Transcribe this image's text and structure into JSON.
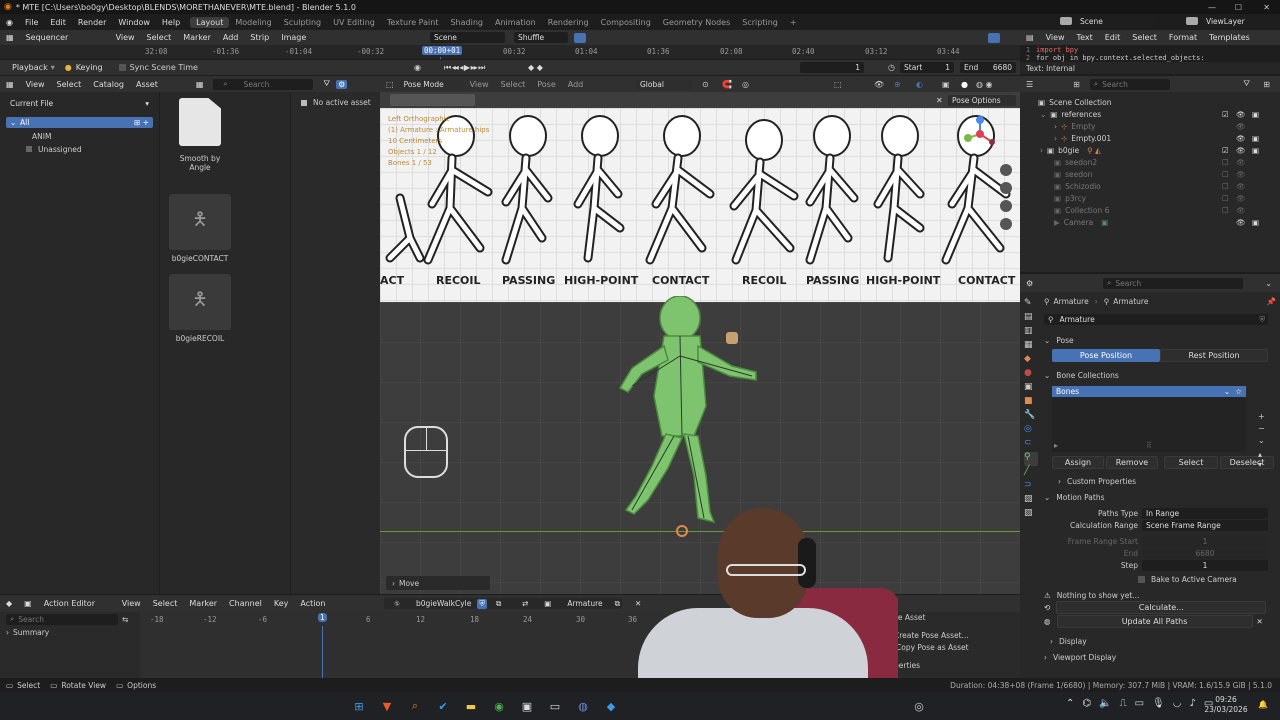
{
  "title_bar": {
    "title": "* MTE [C:\\Users\\bo0gy\\Desktop\\BLENDS\\MORETHANEVER\\MTE.blend] - Blender 5.1.0",
    "minimize": "—",
    "maximize": "☐",
    "close": "✕"
  },
  "top_menu": [
    "File",
    "Edit",
    "Render",
    "Window",
    "Help"
  ],
  "workspaces": [
    "Layout",
    "Modeling",
    "Sculpting",
    "UV Editing",
    "Texture Paint",
    "Shading",
    "Animation",
    "Rendering",
    "Compositing",
    "Geometry Nodes",
    "Scripting"
  ],
  "workspace_add": "+",
  "scene": {
    "name": "Scene",
    "view_layer": "ViewLayer"
  },
  "sequencer": {
    "editor": "Sequencer",
    "menus": [
      "View",
      "Select",
      "Marker",
      "Add",
      "Strip",
      "Image"
    ],
    "scene_field": "Scene",
    "shuffle": "Shuffle",
    "timecodes": [
      "32:08",
      "-01:36",
      "-01:04",
      "-00:32",
      "00:00+01",
      "00:32",
      "01:04",
      "01:36",
      "02:08",
      "02:40",
      "03:12",
      "03:44"
    ]
  },
  "playback_bar": {
    "playback": "Playback",
    "keying": "Keying",
    "sync": "Sync Scene Time",
    "current_frame": "1",
    "start_label": "Start",
    "start": "1",
    "end_label": "End",
    "end": "6680"
  },
  "text_editor": {
    "menus": [
      "View",
      "Text",
      "Edit",
      "Select",
      "Format",
      "Templates"
    ],
    "line1_num": "1",
    "line1": "import bpy",
    "line2_num": "2",
    "line2": "for obj in bpy.context.selected_objects:",
    "status": "Text: Internal"
  },
  "asset_browser": {
    "menus": [
      "View",
      "Select",
      "Catalog",
      "Asset"
    ],
    "search_placeholder": "Search",
    "library": "Current File",
    "no_active": "No active asset",
    "tree": [
      "All",
      "ANIM",
      "Unassigned"
    ],
    "assets": [
      "Smooth by Angle",
      "b0gieCONTACT",
      "b0gieRECOIL"
    ]
  },
  "viewport": {
    "mode": "Pose Mode",
    "menus": [
      "View",
      "Select",
      "Pose",
      "Add"
    ],
    "orientation": "Global",
    "options": "Pose Options",
    "overlay_text": [
      "Left Orthographic",
      "(1) Armature : Armature hips",
      "10 Centimeters",
      "Objects   1 / 12",
      "Bones   1 / 53"
    ],
    "poses": [
      "ACT",
      "RECOIL",
      "PASSING",
      "HIGH-POINT",
      "CONTACT",
      "RECOIL",
      "PASSING",
      "HIGH-POINT",
      "CONTACT"
    ],
    "last_op": "Move"
  },
  "outliner": {
    "search_placeholder": "Search",
    "items": [
      {
        "label": "Scene Collection",
        "color": "#d0d0d0"
      },
      {
        "label": "references",
        "color": "#d0d0d0"
      },
      {
        "label": "Empty",
        "color": "#777"
      },
      {
        "label": "Empty.001",
        "color": "#d0d0d0"
      },
      {
        "label": "b0gie",
        "color": "#d0d0d0"
      },
      {
        "label": "seedon2",
        "color": "#777"
      },
      {
        "label": "seedon",
        "color": "#777"
      },
      {
        "label": "Schizodio",
        "color": "#777"
      },
      {
        "label": "p3rcy",
        "color": "#777"
      },
      {
        "label": "Collection 6",
        "color": "#777"
      },
      {
        "label": "Camera",
        "color": "#777"
      }
    ]
  },
  "properties": {
    "search_placeholder": "Search",
    "crumb1": "Armature",
    "crumb2": "Armature",
    "name_field": "Armature",
    "pose_header": "Pose",
    "pose_position": "Pose Position",
    "rest_position": "Rest Position",
    "bone_collections": "Bone Collections",
    "bones": "Bones",
    "assign": "Assign",
    "remove": "Remove",
    "select": "Select",
    "deselect": "Deselect",
    "custom_props": "Custom Properties",
    "motion_paths": "Motion Paths",
    "paths_type_label": "Paths Type",
    "paths_type": "In Range",
    "calc_range_label": "Calculation Range",
    "calc_range": "Scene Frame Range",
    "frame_start_label": "Frame Range Start",
    "frame_start": "1",
    "end_label": "End",
    "end": "6680",
    "step_label": "Step",
    "step": "1",
    "bake": "Bake to Active Camera",
    "nothing": "Nothing to show yet...",
    "calculate": "Calculate...",
    "update_all": "Update All Paths",
    "display": "Display",
    "viewport_display": "Viewport Display"
  },
  "action_editor": {
    "editor": "Action Editor",
    "menus": [
      "View",
      "Select",
      "Marker",
      "Channel",
      "Key",
      "Action"
    ],
    "action": "b0gieWalkCyle",
    "slot": "Armature",
    "search_placeholder": "Search",
    "summary": "Summary",
    "frames": [
      "-18",
      "-12",
      "-6",
      "1",
      "6",
      "12",
      "18",
      "24",
      "30",
      "36"
    ],
    "menu_items": [
      "se Asset",
      "Create Pose Asset...",
      "Copy Pose as Asset",
      "perties"
    ]
  },
  "status_bar": {
    "items": [
      "Select",
      "Rotate View",
      "Options"
    ],
    "info": "Duration: 04:38+08 (Frame 1/6680) | Memory: 307.7 MiB | VRAM: 1.6/15.9 GiB | 5.1.0"
  },
  "taskbar": {
    "time": "09:26",
    "date": "23/03/2026"
  },
  "colors": {
    "accent": "#4772b3",
    "bone_green": "#7ec46f",
    "webcam_bg": "#3c3c3c"
  }
}
